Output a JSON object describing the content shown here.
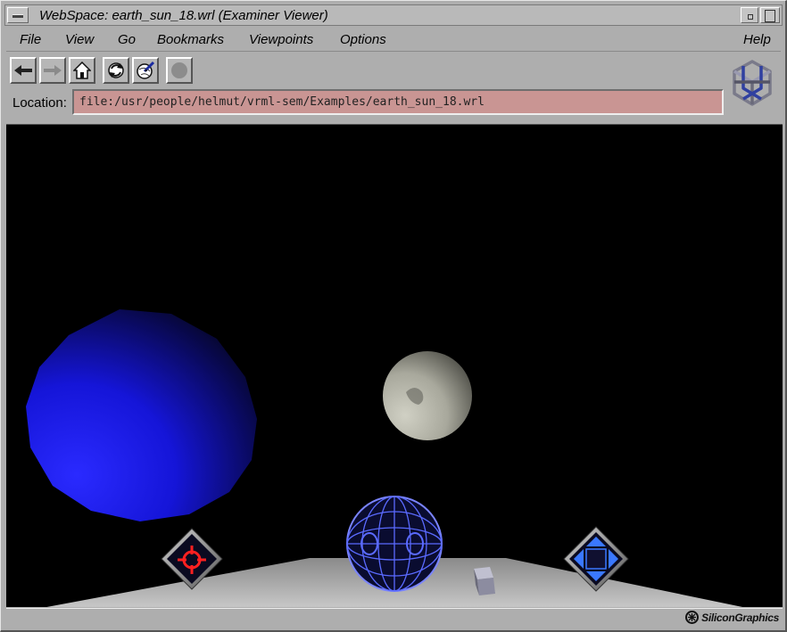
{
  "window": {
    "title": "WebSpace: earth_sun_18.wrl (Examiner Viewer)"
  },
  "menu": {
    "items": [
      {
        "label": "File"
      },
      {
        "label": "View"
      },
      {
        "label": "Go"
      },
      {
        "label": "Bookmarks"
      },
      {
        "label": "Viewpoints"
      },
      {
        "label": "Options"
      }
    ],
    "help": "Help"
  },
  "toolbar": {
    "buttons": [
      {
        "icon": "back-arrow-icon"
      },
      {
        "icon": "forward-arrow-icon",
        "disabled": true
      },
      {
        "icon": "home-icon"
      },
      {
        "icon": "reload-icon"
      },
      {
        "icon": "edit-globe-icon"
      },
      {
        "icon": "stop-icon",
        "disabled": true
      }
    ]
  },
  "location": {
    "label": "Location:",
    "value": "file:/usr/people/helmut/vrml-sem/Examples/earth_sun_18.wrl",
    "field_color": "#c99593"
  },
  "scene": {
    "background_color": "#000000",
    "objects": [
      {
        "name": "blue-sphere",
        "color": "#1515ff"
      },
      {
        "name": "grey-sphere",
        "color": "#c8c8b8"
      }
    ],
    "controls": [
      {
        "icon": "seek-target-icon",
        "accent": "#ff2020"
      },
      {
        "icon": "trackball-icon",
        "accent": "#5a6aff"
      },
      {
        "icon": "zoom-cube-icon"
      },
      {
        "icon": "pan-arrows-icon",
        "accent": "#3a78ff"
      }
    ]
  },
  "status": {
    "brand": "SiliconGraphics"
  }
}
